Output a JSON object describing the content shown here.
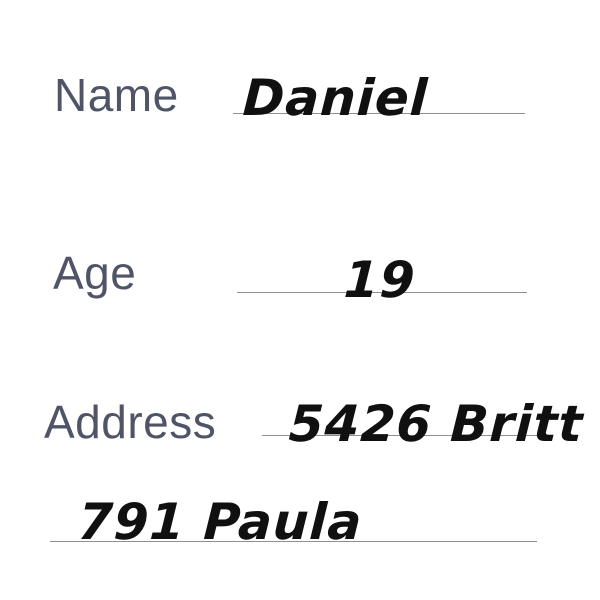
{
  "form": {
    "name": {
      "label": "Name",
      "value": "Daniel"
    },
    "age": {
      "label": "Age",
      "value": "19"
    },
    "address": {
      "label": "Address",
      "line1": "5426 Britt",
      "line2": "791 Paula"
    }
  },
  "colors": {
    "label": "#4f5567",
    "handwriting": "#101010",
    "rule": "#8f8f8f"
  }
}
